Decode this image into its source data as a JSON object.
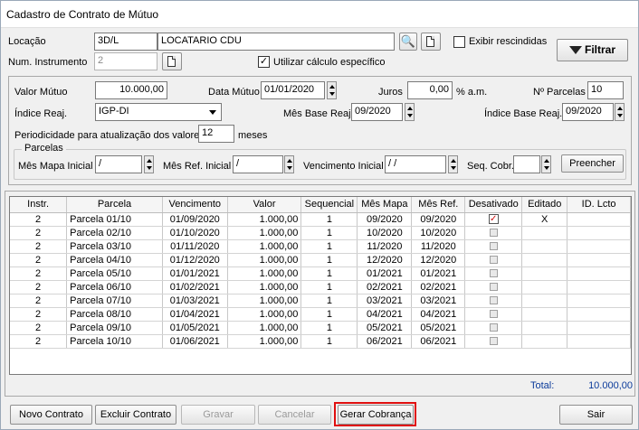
{
  "window": {
    "title": "Cadastro de Contrato de Mútuo"
  },
  "header": {
    "locacao_label": "Locação",
    "locacao_code": "3D/L",
    "locacao_name": "LOCATARIO CDU",
    "instrumento_label": "Num. Instrumento",
    "instrumento_value": "2",
    "exibir_rescindidas_label": "Exibir rescindidas",
    "exibir_rescindidas_checked": false,
    "utilizar_calculo_label": "Utilizar cálculo específico",
    "utilizar_calculo_checked": true,
    "filtrar_label": "Filtrar"
  },
  "form": {
    "valor_mutuo_label": "Valor Mútuo",
    "valor_mutuo_value": "10.000,00",
    "data_mutuo_label": "Data Mútuo",
    "data_mutuo_value": "01/01/2020",
    "juros_label": "Juros",
    "juros_value": "0,00",
    "juros_unit": "% a.m.",
    "num_parcelas_label": "Nº Parcelas",
    "num_parcelas_value": "10",
    "indice_reaj_label": "Índice Reaj.",
    "indice_reaj_value": "IGP-DI",
    "mes_base_reaj_label": "Mês Base Reaj.",
    "mes_base_reaj_value": "09/2020",
    "indice_base_reaj_label": "Índice Base Reaj.",
    "indice_base_reaj_value": "09/2020",
    "periodicidade_label": "Periodicidade para atualização dos valores",
    "periodicidade_value": "12",
    "periodicidade_unit": "meses"
  },
  "parcelas_group": {
    "title": "Parcelas",
    "mes_mapa_inicial_label": "Mês Mapa Inicial",
    "mes_mapa_inicial_value": "  /",
    "mes_ref_inicial_label": "Mês Ref. Inicial",
    "mes_ref_inicial_value": "  /",
    "vencimento_inicial_label": "Vencimento Inicial",
    "vencimento_inicial_value": "  / /",
    "seq_cobr_label": "Seq. Cobr.",
    "seq_cobr_value": "",
    "preencher_label": "Preencher"
  },
  "table": {
    "columns": [
      "Instr.",
      "Parcela",
      "Vencimento",
      "Valor",
      "Sequencial",
      "Mês Mapa",
      "Mês Ref.",
      "Desativado",
      "Editado",
      "ID. Lcto"
    ],
    "rows": [
      [
        "2",
        "Parcela 01/10",
        "01/09/2020",
        "1.000,00",
        "1",
        "09/2020",
        "09/2020",
        "checked",
        "X",
        ""
      ],
      [
        "2",
        "Parcela 02/10",
        "01/10/2020",
        "1.000,00",
        "1",
        "10/2020",
        "10/2020",
        "",
        "",
        ""
      ],
      [
        "2",
        "Parcela 03/10",
        "01/11/2020",
        "1.000,00",
        "1",
        "11/2020",
        "11/2020",
        "",
        "",
        ""
      ],
      [
        "2",
        "Parcela 04/10",
        "01/12/2020",
        "1.000,00",
        "1",
        "12/2020",
        "12/2020",
        "",
        "",
        ""
      ],
      [
        "2",
        "Parcela 05/10",
        "01/01/2021",
        "1.000,00",
        "1",
        "01/2021",
        "01/2021",
        "",
        "",
        ""
      ],
      [
        "2",
        "Parcela 06/10",
        "01/02/2021",
        "1.000,00",
        "1",
        "02/2021",
        "02/2021",
        "",
        "",
        ""
      ],
      [
        "2",
        "Parcela 07/10",
        "01/03/2021",
        "1.000,00",
        "1",
        "03/2021",
        "03/2021",
        "",
        "",
        ""
      ],
      [
        "2",
        "Parcela 08/10",
        "01/04/2021",
        "1.000,00",
        "1",
        "04/2021",
        "04/2021",
        "",
        "",
        ""
      ],
      [
        "2",
        "Parcela 09/10",
        "01/05/2021",
        "1.000,00",
        "1",
        "05/2021",
        "05/2021",
        "",
        "",
        ""
      ],
      [
        "2",
        "Parcela 10/10",
        "01/06/2021",
        "1.000,00",
        "1",
        "06/2021",
        "06/2021",
        "",
        "",
        ""
      ]
    ],
    "total_label": "Total:",
    "total_value": "10.000,00"
  },
  "footer": {
    "novo_contrato": "Novo Contrato",
    "excluir_contrato": "Excluir Contrato",
    "gravar": "Gravar",
    "cancelar": "Cancelar",
    "gerar_cobranca": "Gerar Cobrança",
    "sair": "Sair"
  },
  "colors": {
    "highlight_border": "#e01010",
    "total_text": "#0a3a9a",
    "check_red": "#d01010"
  },
  "icons": [
    "binoculars-icon",
    "document-icon",
    "filter-icon",
    "spin-arrows-icon",
    "dropdown-arrow-icon"
  ]
}
